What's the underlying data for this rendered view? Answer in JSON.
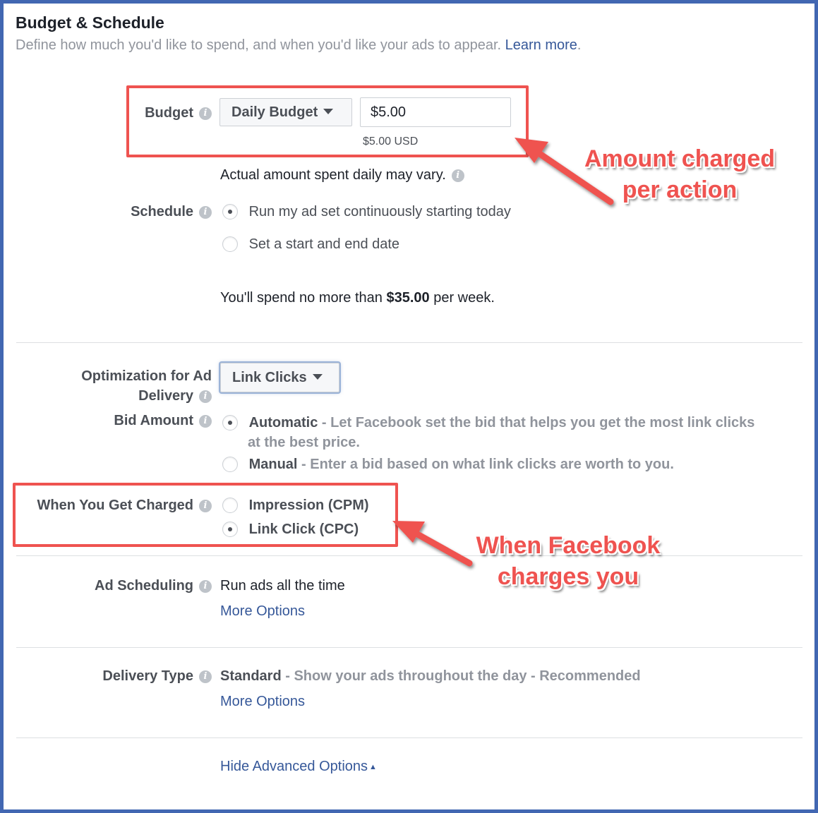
{
  "header": {
    "title": "Budget & Schedule",
    "subtitle": "Define how much you'd like to spend, and when you'd like your ads to appear.",
    "learn_more": "Learn more",
    "period": "."
  },
  "budget": {
    "label": "Budget",
    "type_select": "Daily Budget",
    "amount_value": "$5.00",
    "amount_usd": "$5.00 USD",
    "note": "Actual amount spent daily may vary."
  },
  "schedule": {
    "label": "Schedule",
    "options": [
      {
        "label": "Run my ad set continuously starting today",
        "checked": true
      },
      {
        "label": "Set a start and end date",
        "checked": false
      }
    ],
    "spend_prefix": "You'll spend no more than ",
    "spend_amount": "$35.00",
    "spend_suffix": " per week."
  },
  "optimization": {
    "label_line1": "Optimization for Ad",
    "label_line2": "Delivery",
    "select": "Link Clicks"
  },
  "bid": {
    "label": "Bid Amount",
    "automatic_title": "Automatic",
    "automatic_desc": " - Let Facebook set the bid that helps you get the most link clicks",
    "automatic_desc2": "at the best price.",
    "manual_title": "Manual",
    "manual_desc": " - Enter a bid based on what link clicks are worth to you."
  },
  "charged": {
    "label": "When You Get Charged",
    "options": [
      {
        "label": "Impression (CPM)",
        "checked": false
      },
      {
        "label": "Link Click (CPC)",
        "checked": true
      }
    ]
  },
  "ad_scheduling": {
    "label": "Ad Scheduling",
    "value": "Run ads all the time",
    "more": "More Options"
  },
  "delivery": {
    "label": "Delivery Type",
    "value_bold": "Standard",
    "value_rest": " - Show your ads throughout the day - Recommended",
    "more": "More Options"
  },
  "footer": {
    "hide_advanced": "Hide Advanced Options"
  },
  "annotations": {
    "amount_line1": "Amount charged",
    "amount_line2": "per action",
    "when_line1": "When Facebook",
    "when_line2": "charges you"
  },
  "colors": {
    "accent_red": "#ef5350",
    "link_blue": "#365899",
    "frame_blue": "#4267b2"
  },
  "icons": [
    "info-icon",
    "caret-down-icon",
    "caret-up-icon",
    "arrow-icon"
  ]
}
